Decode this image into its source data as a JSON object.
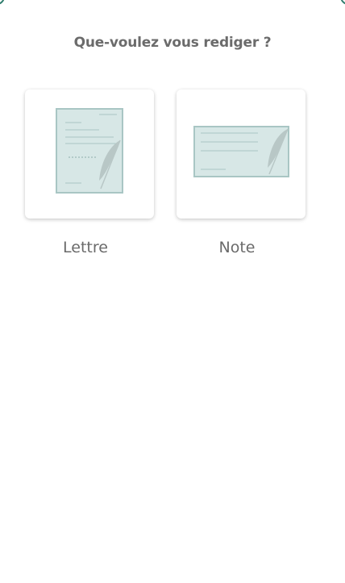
{
  "dialog": {
    "title": "Que-voulez vous rediger ?"
  },
  "options": [
    {
      "label": "Lettre",
      "icon": "letter-document-icon"
    },
    {
      "label": "Note",
      "icon": "note-document-icon"
    }
  ],
  "colors": {
    "accent": "#2f7d6d",
    "paper_fill": "#d7e7e6",
    "paper_stroke": "#a9c6c4",
    "text": "#6b6b6b"
  }
}
